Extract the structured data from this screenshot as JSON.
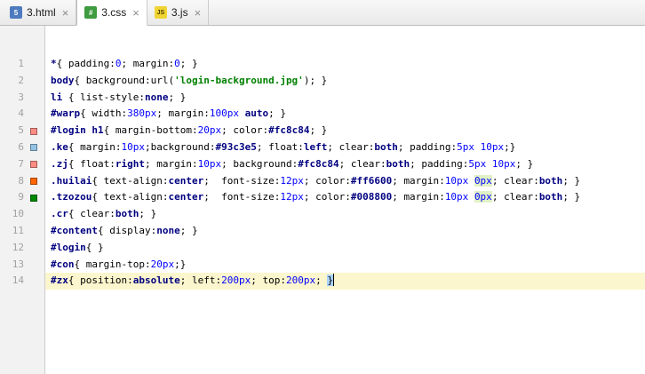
{
  "tab_close_glyph": "×",
  "tabs": [
    {
      "label": "3.html",
      "icon": "html-icon",
      "icon_text": "5",
      "active": false
    },
    {
      "label": "3.css",
      "icon": "css-icon",
      "icon_text": "#",
      "active": true
    },
    {
      "label": "3.js",
      "icon": "js-icon",
      "icon_text": "JS",
      "active": false
    }
  ],
  "colors": {
    "swatch_login": "#fc8c84",
    "swatch_ke": "#93c3e5",
    "swatch_zj": "#fc8c84",
    "swatch_huilai": "#ff6600",
    "swatch_tzozou": "#008800",
    "caret_row": "#fbf6cd",
    "brace_match": "#a8d1ff"
  },
  "editor": {
    "lines": [
      {
        "num": "1",
        "swatch": null,
        "current": false,
        "tokens": [
          {
            "t": "*",
            "c": "s"
          },
          {
            "t": "{ ",
            "c": "t"
          },
          {
            "t": "padding",
            "c": "t"
          },
          {
            "t": ":",
            "c": "t"
          },
          {
            "t": "0",
            "c": "n"
          },
          {
            "t": "; ",
            "c": "t"
          },
          {
            "t": "margin",
            "c": "t"
          },
          {
            "t": ":",
            "c": "t"
          },
          {
            "t": "0",
            "c": "n"
          },
          {
            "t": "; }",
            "c": "t"
          }
        ]
      },
      {
        "num": "2",
        "swatch": null,
        "current": false,
        "tokens": [
          {
            "t": "body",
            "c": "s"
          },
          {
            "t": "{ ",
            "c": "t"
          },
          {
            "t": "background",
            "c": "t"
          },
          {
            "t": ":",
            "c": "t"
          },
          {
            "t": "url",
            "c": "t"
          },
          {
            "t": "(",
            "c": "t"
          },
          {
            "t": "'login-background.jpg'",
            "c": "g"
          },
          {
            "t": ")",
            "c": "t"
          },
          {
            "t": "; }",
            "c": "t"
          }
        ]
      },
      {
        "num": "3",
        "swatch": null,
        "current": false,
        "tokens": [
          {
            "t": "li",
            "c": "s"
          },
          {
            "t": " { ",
            "c": "t"
          },
          {
            "t": "list-style",
            "c": "t"
          },
          {
            "t": ":",
            "c": "t"
          },
          {
            "t": "none",
            "c": "k"
          },
          {
            "t": "; }",
            "c": "t"
          }
        ]
      },
      {
        "num": "4",
        "swatch": null,
        "current": false,
        "tokens": [
          {
            "t": "#warp",
            "c": "s"
          },
          {
            "t": "{ ",
            "c": "t"
          },
          {
            "t": "width",
            "c": "t"
          },
          {
            "t": ":",
            "c": "t"
          },
          {
            "t": "380px",
            "c": "n"
          },
          {
            "t": "; ",
            "c": "t"
          },
          {
            "t": "margin",
            "c": "t"
          },
          {
            "t": ":",
            "c": "t"
          },
          {
            "t": "100px",
            "c": "n"
          },
          {
            "t": " ",
            "c": "t"
          },
          {
            "t": "auto",
            "c": "k"
          },
          {
            "t": "; }",
            "c": "t"
          }
        ]
      },
      {
        "num": "5",
        "swatch": "#fc8c84",
        "current": false,
        "tokens": [
          {
            "t": "#login h1",
            "c": "s"
          },
          {
            "t": "{ ",
            "c": "t"
          },
          {
            "t": "margin-bottom",
            "c": "t"
          },
          {
            "t": ":",
            "c": "t"
          },
          {
            "t": "20px",
            "c": "n"
          },
          {
            "t": "; ",
            "c": "t"
          },
          {
            "t": "color",
            "c": "t"
          },
          {
            "t": ":",
            "c": "t"
          },
          {
            "t": "#fc8c84",
            "c": "h"
          },
          {
            "t": "; }",
            "c": "t"
          }
        ]
      },
      {
        "num": "6",
        "swatch": "#93c3e5",
        "current": false,
        "tokens": [
          {
            "t": ".ke",
            "c": "s"
          },
          {
            "t": "{ ",
            "c": "t"
          },
          {
            "t": "margin",
            "c": "t"
          },
          {
            "t": ":",
            "c": "t"
          },
          {
            "t": "10px",
            "c": "n"
          },
          {
            "t": ";",
            "c": "t"
          },
          {
            "t": "background",
            "c": "t"
          },
          {
            "t": ":",
            "c": "t"
          },
          {
            "t": "#93c3e5",
            "c": "h"
          },
          {
            "t": "; ",
            "c": "t"
          },
          {
            "t": "float",
            "c": "t"
          },
          {
            "t": ":",
            "c": "t"
          },
          {
            "t": "left",
            "c": "k"
          },
          {
            "t": "; ",
            "c": "t"
          },
          {
            "t": "clear",
            "c": "t"
          },
          {
            "t": ":",
            "c": "t"
          },
          {
            "t": "both",
            "c": "k"
          },
          {
            "t": "; ",
            "c": "t"
          },
          {
            "t": "padding",
            "c": "t"
          },
          {
            "t": ":",
            "c": "t"
          },
          {
            "t": "5px",
            "c": "n"
          },
          {
            "t": " ",
            "c": "t"
          },
          {
            "t": "10px",
            "c": "n"
          },
          {
            "t": ";}",
            "c": "t"
          }
        ]
      },
      {
        "num": "7",
        "swatch": "#fc8c84",
        "current": false,
        "tokens": [
          {
            "t": ".zj",
            "c": "s"
          },
          {
            "t": "{ ",
            "c": "t"
          },
          {
            "t": "float",
            "c": "t"
          },
          {
            "t": ":",
            "c": "t"
          },
          {
            "t": "right",
            "c": "k"
          },
          {
            "t": "; ",
            "c": "t"
          },
          {
            "t": "margin",
            "c": "t"
          },
          {
            "t": ":",
            "c": "t"
          },
          {
            "t": "10px",
            "c": "n"
          },
          {
            "t": "; ",
            "c": "t"
          },
          {
            "t": "background",
            "c": "t"
          },
          {
            "t": ":",
            "c": "t"
          },
          {
            "t": "#fc8c84",
            "c": "h"
          },
          {
            "t": "; ",
            "c": "t"
          },
          {
            "t": "clear",
            "c": "t"
          },
          {
            "t": ":",
            "c": "t"
          },
          {
            "t": "both",
            "c": "k"
          },
          {
            "t": "; ",
            "c": "t"
          },
          {
            "t": "padding",
            "c": "t"
          },
          {
            "t": ":",
            "c": "t"
          },
          {
            "t": "5px",
            "c": "n"
          },
          {
            "t": " ",
            "c": "t"
          },
          {
            "t": "10px",
            "c": "n"
          },
          {
            "t": "; }",
            "c": "t"
          }
        ]
      },
      {
        "num": "8",
        "swatch": "#ff6600",
        "current": false,
        "tokens": [
          {
            "t": ".huilai",
            "c": "s"
          },
          {
            "t": "{ ",
            "c": "t"
          },
          {
            "t": "text-align",
            "c": "t"
          },
          {
            "t": ":",
            "c": "t"
          },
          {
            "t": "center",
            "c": "k"
          },
          {
            "t": ";  ",
            "c": "t"
          },
          {
            "t": "font-size",
            "c": "t"
          },
          {
            "t": ":",
            "c": "t"
          },
          {
            "t": "12px",
            "c": "n"
          },
          {
            "t": "; ",
            "c": "t"
          },
          {
            "t": "color",
            "c": "t"
          },
          {
            "t": ":",
            "c": "t"
          },
          {
            "t": "#ff6600",
            "c": "h"
          },
          {
            "t": "; ",
            "c": "t"
          },
          {
            "t": "margin",
            "c": "t"
          },
          {
            "t": ":",
            "c": "t"
          },
          {
            "t": "10px",
            "c": "n"
          },
          {
            "t": " ",
            "c": "t"
          },
          {
            "t": "0px",
            "c": "n hl"
          },
          {
            "t": "; ",
            "c": "t"
          },
          {
            "t": "clear",
            "c": "t"
          },
          {
            "t": ":",
            "c": "t"
          },
          {
            "t": "both",
            "c": "k"
          },
          {
            "t": "; }",
            "c": "t"
          }
        ]
      },
      {
        "num": "9",
        "swatch": "#008800",
        "current": false,
        "tokens": [
          {
            "t": ".tzozou",
            "c": "s"
          },
          {
            "t": "{ ",
            "c": "t"
          },
          {
            "t": "text-align",
            "c": "t"
          },
          {
            "t": ":",
            "c": "t"
          },
          {
            "t": "center",
            "c": "k"
          },
          {
            "t": ";  ",
            "c": "t"
          },
          {
            "t": "font-size",
            "c": "t"
          },
          {
            "t": ":",
            "c": "t"
          },
          {
            "t": "12px",
            "c": "n"
          },
          {
            "t": "; ",
            "c": "t"
          },
          {
            "t": "color",
            "c": "t"
          },
          {
            "t": ":",
            "c": "t"
          },
          {
            "t": "#008800",
            "c": "h"
          },
          {
            "t": "; ",
            "c": "t"
          },
          {
            "t": "margin",
            "c": "t"
          },
          {
            "t": ":",
            "c": "t"
          },
          {
            "t": "10px",
            "c": "n"
          },
          {
            "t": " ",
            "c": "t"
          },
          {
            "t": "0px",
            "c": "n hl"
          },
          {
            "t": "; ",
            "c": "t"
          },
          {
            "t": "clear",
            "c": "t"
          },
          {
            "t": ":",
            "c": "t"
          },
          {
            "t": "both",
            "c": "k"
          },
          {
            "t": "; }",
            "c": "t"
          }
        ]
      },
      {
        "num": "10",
        "swatch": null,
        "current": false,
        "tokens": [
          {
            "t": ".cr",
            "c": "s"
          },
          {
            "t": "{ ",
            "c": "t"
          },
          {
            "t": "clear",
            "c": "t"
          },
          {
            "t": ":",
            "c": "t"
          },
          {
            "t": "both",
            "c": "k"
          },
          {
            "t": "; }",
            "c": "t"
          }
        ]
      },
      {
        "num": "11",
        "swatch": null,
        "current": false,
        "tokens": [
          {
            "t": "#content",
            "c": "s"
          },
          {
            "t": "{ ",
            "c": "t"
          },
          {
            "t": "display",
            "c": "t"
          },
          {
            "t": ":",
            "c": "t"
          },
          {
            "t": "none",
            "c": "k"
          },
          {
            "t": "; }",
            "c": "t"
          }
        ]
      },
      {
        "num": "12",
        "swatch": null,
        "current": false,
        "tokens": [
          {
            "t": "#login",
            "c": "s"
          },
          {
            "t": "{ }",
            "c": "t"
          }
        ]
      },
      {
        "num": "13",
        "swatch": null,
        "current": false,
        "tokens": [
          {
            "t": "#con",
            "c": "s"
          },
          {
            "t": "{ ",
            "c": "t"
          },
          {
            "t": "margin-top",
            "c": "t"
          },
          {
            "t": ":",
            "c": "t"
          },
          {
            "t": "20px",
            "c": "n"
          },
          {
            "t": ";}",
            "c": "t"
          }
        ]
      },
      {
        "num": "14",
        "swatch": null,
        "current": true,
        "tokens": [
          {
            "t": "#zx",
            "c": "s"
          },
          {
            "t": "{ ",
            "c": "t"
          },
          {
            "t": "position",
            "c": "t"
          },
          {
            "t": ":",
            "c": "t"
          },
          {
            "t": "absolute",
            "c": "k"
          },
          {
            "t": "; ",
            "c": "t"
          },
          {
            "t": "left",
            "c": "t"
          },
          {
            "t": ":",
            "c": "t"
          },
          {
            "t": "200px",
            "c": "n"
          },
          {
            "t": "; ",
            "c": "t"
          },
          {
            "t": "top",
            "c": "t"
          },
          {
            "t": ":",
            "c": "t"
          },
          {
            "t": "200px",
            "c": "n"
          },
          {
            "t": "; ",
            "c": "t"
          },
          {
            "t": "}",
            "c": "t bm"
          },
          {
            "t": "",
            "c": "caret"
          }
        ]
      }
    ]
  }
}
